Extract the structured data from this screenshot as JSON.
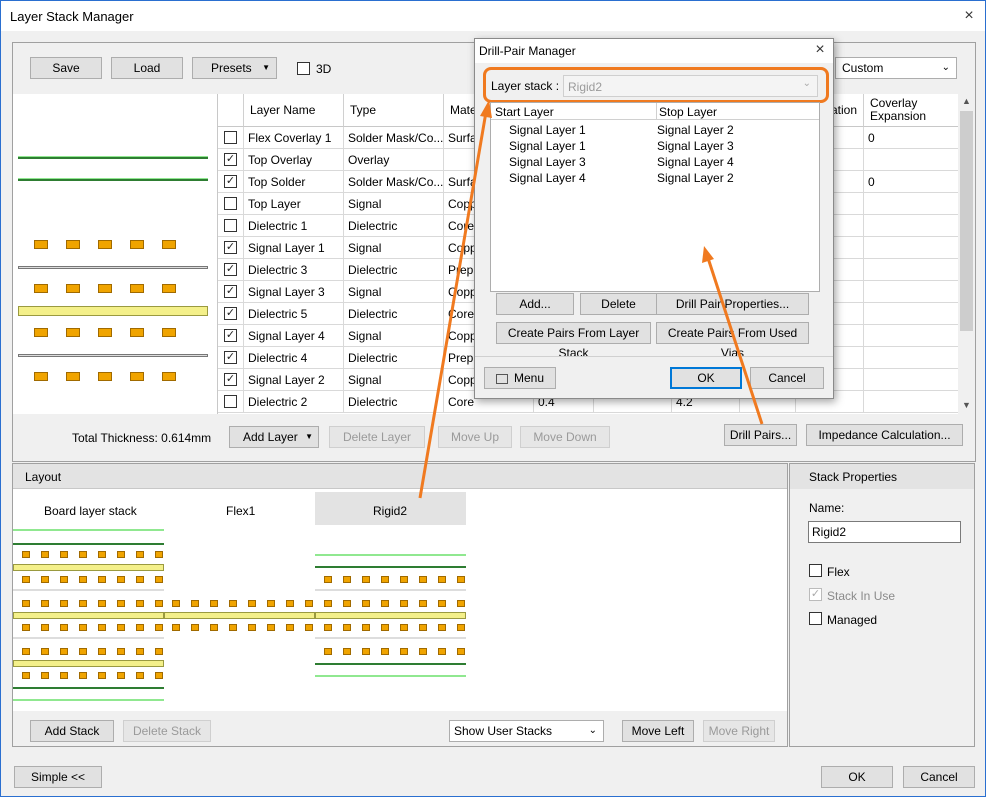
{
  "window": {
    "title": "Layer Stack Manager",
    "close_icon": "×"
  },
  "toolbar": {
    "save": "Save",
    "load": "Load",
    "presets": "Presets",
    "threed": "3D",
    "custom": "Custom"
  },
  "grid": {
    "headers": [
      "Layer Name",
      "Type",
      "Mate",
      "ation",
      "Coverlay Expansion"
    ],
    "rows": [
      {
        "checked": false,
        "name": "Flex Coverlay 1",
        "type": "Solder Mask/Co...",
        "mat": "Surfa",
        "exp": "0"
      },
      {
        "checked": true,
        "name": "Top Overlay",
        "type": "Overlay",
        "mat": "",
        "exp": ""
      },
      {
        "checked": true,
        "name": "Top Solder",
        "type": "Solder Mask/Co...",
        "mat": "Surfa",
        "exp": "0"
      },
      {
        "checked": false,
        "name": "Top Layer",
        "type": "Signal",
        "mat": "Copp",
        "exp": ""
      },
      {
        "checked": false,
        "name": "Dielectric 1",
        "type": "Dielectric",
        "mat": "Core",
        "exp": ""
      },
      {
        "checked": true,
        "name": "Signal Layer 1",
        "type": "Signal",
        "mat": "Copp",
        "exp": ""
      },
      {
        "checked": true,
        "name": "Dielectric 3",
        "type": "Dielectric",
        "mat": "Prepr",
        "exp": ""
      },
      {
        "checked": true,
        "name": "Signal Layer 3",
        "type": "Signal",
        "mat": "Copp",
        "exp": ""
      },
      {
        "checked": true,
        "name": "Dielectric 5",
        "type": "Dielectric",
        "mat": "Core",
        "exp": ""
      },
      {
        "checked": true,
        "name": "Signal Layer 4",
        "type": "Signal",
        "mat": "Copp",
        "exp": ""
      },
      {
        "checked": true,
        "name": "Dielectric 4",
        "type": "Dielectric",
        "mat": "Prepr",
        "exp": ""
      },
      {
        "checked": true,
        "name": "Signal Layer 2",
        "type": "Signal",
        "mat": "Copp",
        "exp": ""
      },
      {
        "checked": false,
        "name": "Dielectric 2",
        "type": "Dielectric",
        "mat": "Core",
        "exp": ""
      }
    ],
    "extra_val1": "0.4",
    "extra_val2": "4.2"
  },
  "actions": {
    "total": "Total Thickness: 0.614mm",
    "add_layer": "Add Layer",
    "delete_layer": "Delete Layer",
    "move_up": "Move Up",
    "move_down": "Move Down",
    "drill_pairs": "Drill Pairs...",
    "impedance": "Impedance Calculation..."
  },
  "layout": {
    "title": "Layout",
    "stacks": [
      "Board layer stack",
      "Flex1",
      "Rigid2"
    ],
    "add_stack": "Add Stack",
    "delete_stack": "Delete Stack",
    "show": "Show User Stacks",
    "move_left": "Move Left",
    "move_right": "Move Right"
  },
  "props": {
    "title": "Stack Properties",
    "name_label": "Name:",
    "name_value": "Rigid2",
    "flex": "Flex",
    "in_use": "Stack In Use",
    "managed": "Managed"
  },
  "footer": {
    "simple": "Simple <<",
    "ok": "OK",
    "cancel": "Cancel"
  },
  "dialog": {
    "title": "Drill-Pair Manager",
    "stack_label": "Layer stack :",
    "stack_value": "Rigid2",
    "col_start": "Start Layer",
    "col_stop": "Stop Layer",
    "pairs": [
      [
        "Signal Layer 1",
        "Signal Layer 2"
      ],
      [
        "Signal Layer 1",
        "Signal Layer 3"
      ],
      [
        "Signal Layer 3",
        "Signal Layer 4"
      ],
      [
        "Signal Layer 4",
        "Signal Layer 2"
      ]
    ],
    "add": "Add...",
    "delete": "Delete",
    "props": "Drill Pair Properties...",
    "from_stack": "Create Pairs From Layer Stack",
    "from_vias": "Create Pairs From Used Vias",
    "menu": "Menu",
    "ok": "OK",
    "cancel": "Cancel"
  },
  "colors": {
    "accent": "#0078d7",
    "highlight": "#f07a20",
    "pad": "#f0a400",
    "flex_line": "#90e890",
    "copper_line": "#2e7d32"
  }
}
